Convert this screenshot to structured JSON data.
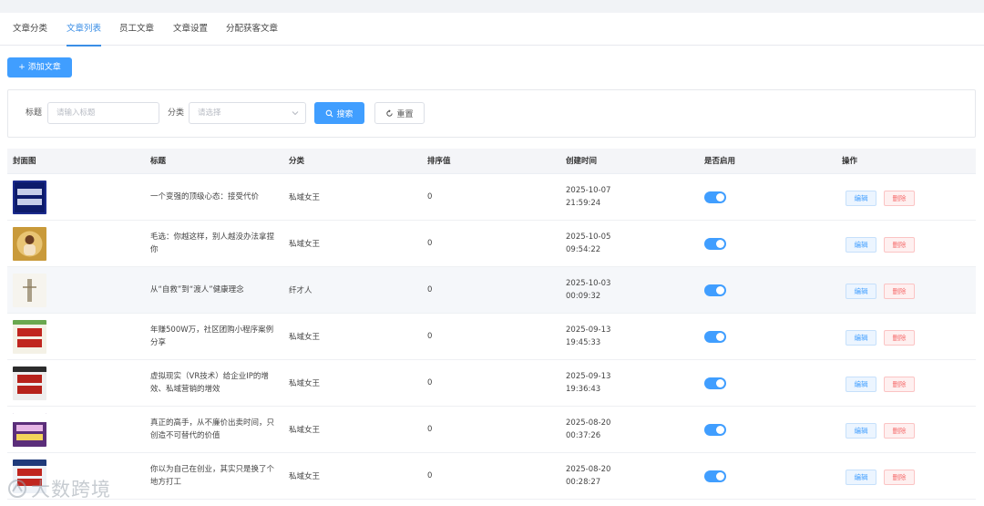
{
  "tabs": [
    {
      "label": "文章分类",
      "active": false
    },
    {
      "label": "文章列表",
      "active": true
    },
    {
      "label": "员工文章",
      "active": false
    },
    {
      "label": "文章设置",
      "active": false
    },
    {
      "label": "分配获客文章",
      "active": false
    }
  ],
  "toolbar": {
    "add_label": "+ 添加文章"
  },
  "filter": {
    "title_label": "标题",
    "title_placeholder": "请输入标题",
    "category_label": "分类",
    "category_placeholder": "请选择",
    "search_label": "搜索",
    "reset_label": "重置"
  },
  "table": {
    "columns": [
      "封面图",
      "标题",
      "分类",
      "排序值",
      "创建时间",
      "是否启用",
      "操作"
    ],
    "edit_label": "编辑",
    "delete_label": "删除",
    "rows": [
      {
        "cover": "顶级心态",
        "title": "一个变强的顶级心态：接受代价",
        "category": "私域女王",
        "sort": "0",
        "date": "2025-10-07",
        "time": "21:59:24",
        "enabled": true
      },
      {
        "cover": "portrait",
        "title": "毛选：你越这样，别人越没办法拿捏你",
        "category": "私域女王",
        "sort": "0",
        "date": "2025-10-05",
        "time": "09:54:22",
        "enabled": true
      },
      {
        "cover": "纤才人",
        "title": "从“自救”到“渡人”健康理念",
        "category": "纤才人",
        "sort": "0",
        "date": "2025-10-03",
        "time": "00:09:32",
        "enabled": true
      },
      {
        "cover": "营销案例",
        "title": "年赚500W万，社区团购小程序案例分享",
        "category": "私域女王",
        "sort": "0",
        "date": "2025-09-13",
        "time": "19:45:33",
        "enabled": true
      },
      {
        "cover": "营销增效",
        "title": "虚拟现实（VR技术）给企业IP的增效、私域营销的增效",
        "category": "私域女王",
        "sort": "0",
        "date": "2025-09-13",
        "time": "19:36:43",
        "enabled": true
      },
      {
        "cover": "banner",
        "title": "真正的高手，从不廉价出卖时间，只创造不可替代的价值",
        "category": "私域女王",
        "sort": "0",
        "date": "2025-08-20",
        "time": "00:37:26",
        "enabled": true
      },
      {
        "cover": "资产",
        "title": "你以为自己在创业，其实只是换了个地方打工",
        "category": "私域女王",
        "sort": "0",
        "date": "2025-08-20",
        "time": "00:28:27",
        "enabled": true
      }
    ]
  },
  "watermark": {
    "text": "大数跨境"
  },
  "colors": {
    "primary": "#409eff",
    "danger": "#f56c6c",
    "header_bg": "#f4f5f8",
    "row_highlight": "#f5f7fa"
  }
}
